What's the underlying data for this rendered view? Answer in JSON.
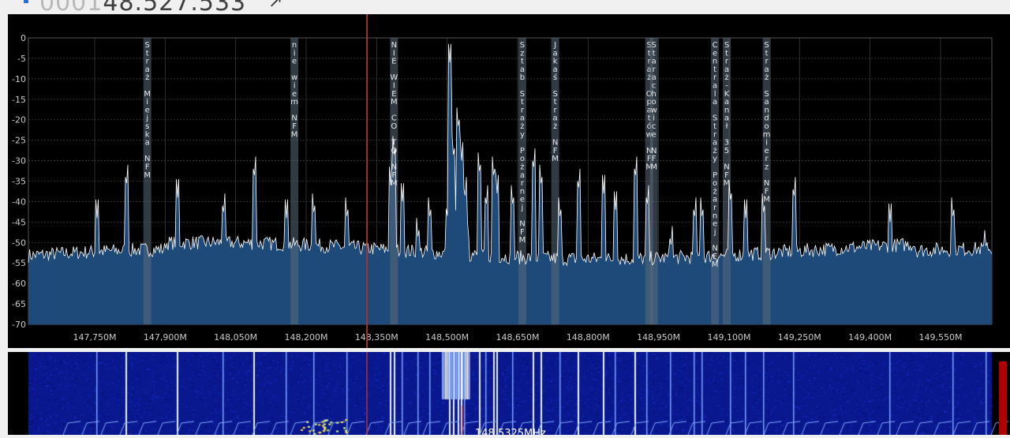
{
  "header": {
    "frequency_dim": "0001",
    "frequency_main": "48.527.533"
  },
  "colors": {
    "spectrum_fill": "#1d4a78",
    "trace": "#ffffff",
    "grid": "#3a3a3a",
    "marker_line": "#b03030",
    "bookmark_band": "#5a6a7a",
    "waterfall_bg": "#0a1890"
  },
  "spectrum": {
    "y_ticks": [
      "0",
      "-5",
      "-10",
      "-15",
      "-20",
      "-25",
      "-30",
      "-35",
      "-40",
      "-45",
      "-50",
      "-55",
      "-60",
      "-65",
      "-70"
    ],
    "x_ticks": [
      "147,750M",
      "147,900M",
      "148,050M",
      "148,200M",
      "148,350M",
      "148,500M",
      "148,650M",
      "148,800M",
      "148,950M",
      "149,100M",
      "149,250M",
      "149,400M",
      "149,550M"
    ],
    "center_freq_mhz": 148.3294,
    "bookmarks": [
      {
        "label": "Straż Miejska NFM",
        "freq_mhz": 147.862
      },
      {
        "label": "nie wiem NFM",
        "freq_mhz": 148.175
      },
      {
        "label": "NIE WIEM CO TO NFM",
        "freq_mhz": 148.387
      },
      {
        "label": "Sztab Straży Pożarnej NFM",
        "freq_mhz": 148.66
      },
      {
        "label": "Jakaś Straż NFM",
        "freq_mhz": 148.73
      },
      {
        "label": "Straż Opatów NFM",
        "freq_mhz": 148.93
      },
      {
        "label": "Starachowice NFM",
        "freq_mhz": 148.94
      },
      {
        "label": "Centrala Straży Pożarnej NFM",
        "freq_mhz": 149.07
      },
      {
        "label": "Straż-Kanał 35 NFM",
        "freq_mhz": 149.095
      },
      {
        "label": "Straż Sandomierz NFM",
        "freq_mhz": 149.18
      }
    ]
  },
  "waterfall": {
    "demod_marker_label": "148,5325MHz"
  }
}
